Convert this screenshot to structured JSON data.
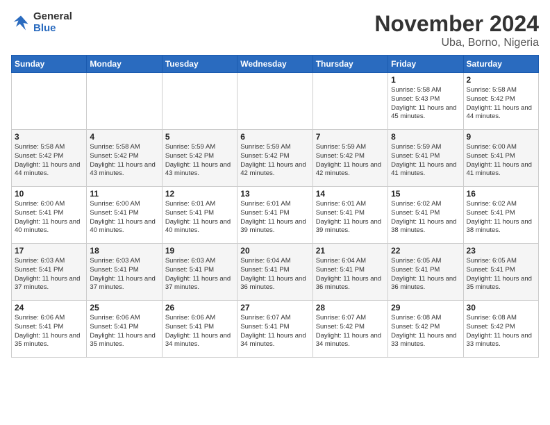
{
  "logo": {
    "general": "General",
    "blue": "Blue"
  },
  "title": "November 2024",
  "location": "Uba, Borno, Nigeria",
  "days_of_week": [
    "Sunday",
    "Monday",
    "Tuesday",
    "Wednesday",
    "Thursday",
    "Friday",
    "Saturday"
  ],
  "weeks": [
    [
      {
        "day": "",
        "info": ""
      },
      {
        "day": "",
        "info": ""
      },
      {
        "day": "",
        "info": ""
      },
      {
        "day": "",
        "info": ""
      },
      {
        "day": "",
        "info": ""
      },
      {
        "day": "1",
        "info": "Sunrise: 5:58 AM\nSunset: 5:43 PM\nDaylight: 11 hours and 45 minutes."
      },
      {
        "day": "2",
        "info": "Sunrise: 5:58 AM\nSunset: 5:42 PM\nDaylight: 11 hours and 44 minutes."
      }
    ],
    [
      {
        "day": "3",
        "info": "Sunrise: 5:58 AM\nSunset: 5:42 PM\nDaylight: 11 hours and 44 minutes."
      },
      {
        "day": "4",
        "info": "Sunrise: 5:58 AM\nSunset: 5:42 PM\nDaylight: 11 hours and 43 minutes."
      },
      {
        "day": "5",
        "info": "Sunrise: 5:59 AM\nSunset: 5:42 PM\nDaylight: 11 hours and 43 minutes."
      },
      {
        "day": "6",
        "info": "Sunrise: 5:59 AM\nSunset: 5:42 PM\nDaylight: 11 hours and 42 minutes."
      },
      {
        "day": "7",
        "info": "Sunrise: 5:59 AM\nSunset: 5:42 PM\nDaylight: 11 hours and 42 minutes."
      },
      {
        "day": "8",
        "info": "Sunrise: 5:59 AM\nSunset: 5:41 PM\nDaylight: 11 hours and 41 minutes."
      },
      {
        "day": "9",
        "info": "Sunrise: 6:00 AM\nSunset: 5:41 PM\nDaylight: 11 hours and 41 minutes."
      }
    ],
    [
      {
        "day": "10",
        "info": "Sunrise: 6:00 AM\nSunset: 5:41 PM\nDaylight: 11 hours and 40 minutes."
      },
      {
        "day": "11",
        "info": "Sunrise: 6:00 AM\nSunset: 5:41 PM\nDaylight: 11 hours and 40 minutes."
      },
      {
        "day": "12",
        "info": "Sunrise: 6:01 AM\nSunset: 5:41 PM\nDaylight: 11 hours and 40 minutes."
      },
      {
        "day": "13",
        "info": "Sunrise: 6:01 AM\nSunset: 5:41 PM\nDaylight: 11 hours and 39 minutes."
      },
      {
        "day": "14",
        "info": "Sunrise: 6:01 AM\nSunset: 5:41 PM\nDaylight: 11 hours and 39 minutes."
      },
      {
        "day": "15",
        "info": "Sunrise: 6:02 AM\nSunset: 5:41 PM\nDaylight: 11 hours and 38 minutes."
      },
      {
        "day": "16",
        "info": "Sunrise: 6:02 AM\nSunset: 5:41 PM\nDaylight: 11 hours and 38 minutes."
      }
    ],
    [
      {
        "day": "17",
        "info": "Sunrise: 6:03 AM\nSunset: 5:41 PM\nDaylight: 11 hours and 37 minutes."
      },
      {
        "day": "18",
        "info": "Sunrise: 6:03 AM\nSunset: 5:41 PM\nDaylight: 11 hours and 37 minutes."
      },
      {
        "day": "19",
        "info": "Sunrise: 6:03 AM\nSunset: 5:41 PM\nDaylight: 11 hours and 37 minutes."
      },
      {
        "day": "20",
        "info": "Sunrise: 6:04 AM\nSunset: 5:41 PM\nDaylight: 11 hours and 36 minutes."
      },
      {
        "day": "21",
        "info": "Sunrise: 6:04 AM\nSunset: 5:41 PM\nDaylight: 11 hours and 36 minutes."
      },
      {
        "day": "22",
        "info": "Sunrise: 6:05 AM\nSunset: 5:41 PM\nDaylight: 11 hours and 36 minutes."
      },
      {
        "day": "23",
        "info": "Sunrise: 6:05 AM\nSunset: 5:41 PM\nDaylight: 11 hours and 35 minutes."
      }
    ],
    [
      {
        "day": "24",
        "info": "Sunrise: 6:06 AM\nSunset: 5:41 PM\nDaylight: 11 hours and 35 minutes."
      },
      {
        "day": "25",
        "info": "Sunrise: 6:06 AM\nSunset: 5:41 PM\nDaylight: 11 hours and 35 minutes."
      },
      {
        "day": "26",
        "info": "Sunrise: 6:06 AM\nSunset: 5:41 PM\nDaylight: 11 hours and 34 minutes."
      },
      {
        "day": "27",
        "info": "Sunrise: 6:07 AM\nSunset: 5:41 PM\nDaylight: 11 hours and 34 minutes."
      },
      {
        "day": "28",
        "info": "Sunrise: 6:07 AM\nSunset: 5:42 PM\nDaylight: 11 hours and 34 minutes."
      },
      {
        "day": "29",
        "info": "Sunrise: 6:08 AM\nSunset: 5:42 PM\nDaylight: 11 hours and 33 minutes."
      },
      {
        "day": "30",
        "info": "Sunrise: 6:08 AM\nSunset: 5:42 PM\nDaylight: 11 hours and 33 minutes."
      }
    ]
  ]
}
